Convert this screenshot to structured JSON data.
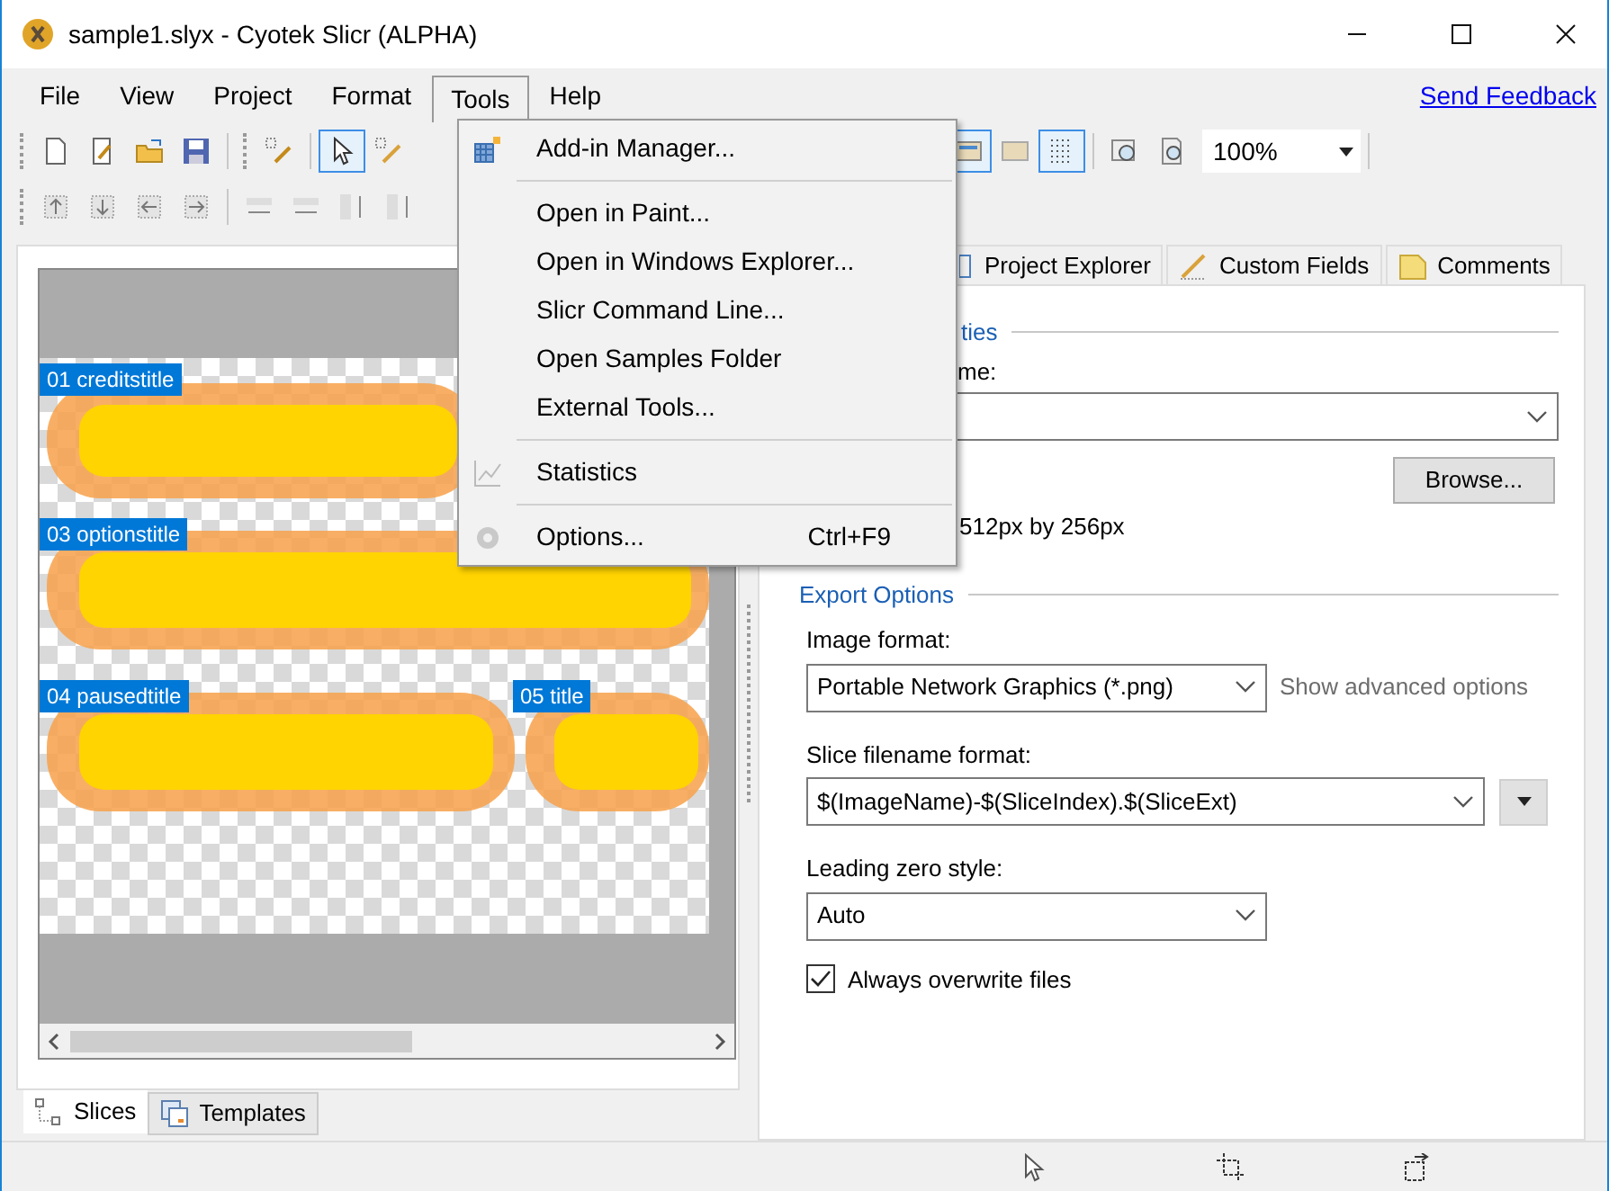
{
  "window": {
    "title": "sample1.slyx - Cyotek Slicr (ALPHA)"
  },
  "menu_bar": [
    {
      "label": "File",
      "selected": false
    },
    {
      "label": "View",
      "selected": false
    },
    {
      "label": "Project",
      "selected": false
    },
    {
      "label": "Format",
      "selected": false
    },
    {
      "label": "Tools",
      "selected": true
    },
    {
      "label": "Help",
      "selected": false
    }
  ],
  "feedback_link": "Send Feedback",
  "toolbar": {
    "zoom": "100%"
  },
  "tools_menu": [
    {
      "kind": "item",
      "label": "Add-in Manager...",
      "disabled": false
    },
    {
      "kind": "separator"
    },
    {
      "kind": "item",
      "label": "Open in Paint...",
      "disabled": false
    },
    {
      "kind": "item",
      "label": "Open in Windows Explorer...",
      "disabled": false
    },
    {
      "kind": "item",
      "label": "Slicr Command Line...",
      "disabled": false
    },
    {
      "kind": "item",
      "label": "Open Samples Folder",
      "disabled": false
    },
    {
      "kind": "item",
      "label": "External Tools...",
      "disabled": false
    },
    {
      "kind": "separator"
    },
    {
      "kind": "item",
      "label": "Statistics",
      "disabled": false
    },
    {
      "kind": "separator"
    },
    {
      "kind": "item",
      "label": "Options...",
      "shortcut": "Ctrl+F9",
      "disabled": false
    }
  ],
  "slices": [
    {
      "label": "01 creditstitle"
    },
    {
      "label": "03 optionstitle"
    },
    {
      "label": "04 pausedtitle"
    },
    {
      "label": "05 title"
    }
  ],
  "bottom_tabs": [
    {
      "label": "Slices",
      "selected": true
    },
    {
      "label": "Templates",
      "selected": false
    }
  ],
  "right_tabs": [
    {
      "label": "Project Explorer",
      "selected": false
    },
    {
      "label": "Custom Fields",
      "selected": false
    },
    {
      "label": "Comments",
      "selected": false
    }
  ],
  "properties": {
    "group_fragment": "ties",
    "label_fragment": "me:",
    "size": "512px by 256px",
    "browse_button": "Browse..."
  },
  "export_options": {
    "title": "Export Options",
    "image_format": {
      "label": "Image format:",
      "value": "Portable Network Graphics (*.png)",
      "link": "Show advanced options"
    },
    "slice_filename": {
      "label": "Slice filename format:",
      "value": "$(ImageName)-$(SliceIndex).$(SliceExt)"
    },
    "leading_zero": {
      "label": "Leading zero style:",
      "value": "Auto"
    },
    "overwrite": {
      "label": "Always overwrite files",
      "checked": true
    }
  }
}
